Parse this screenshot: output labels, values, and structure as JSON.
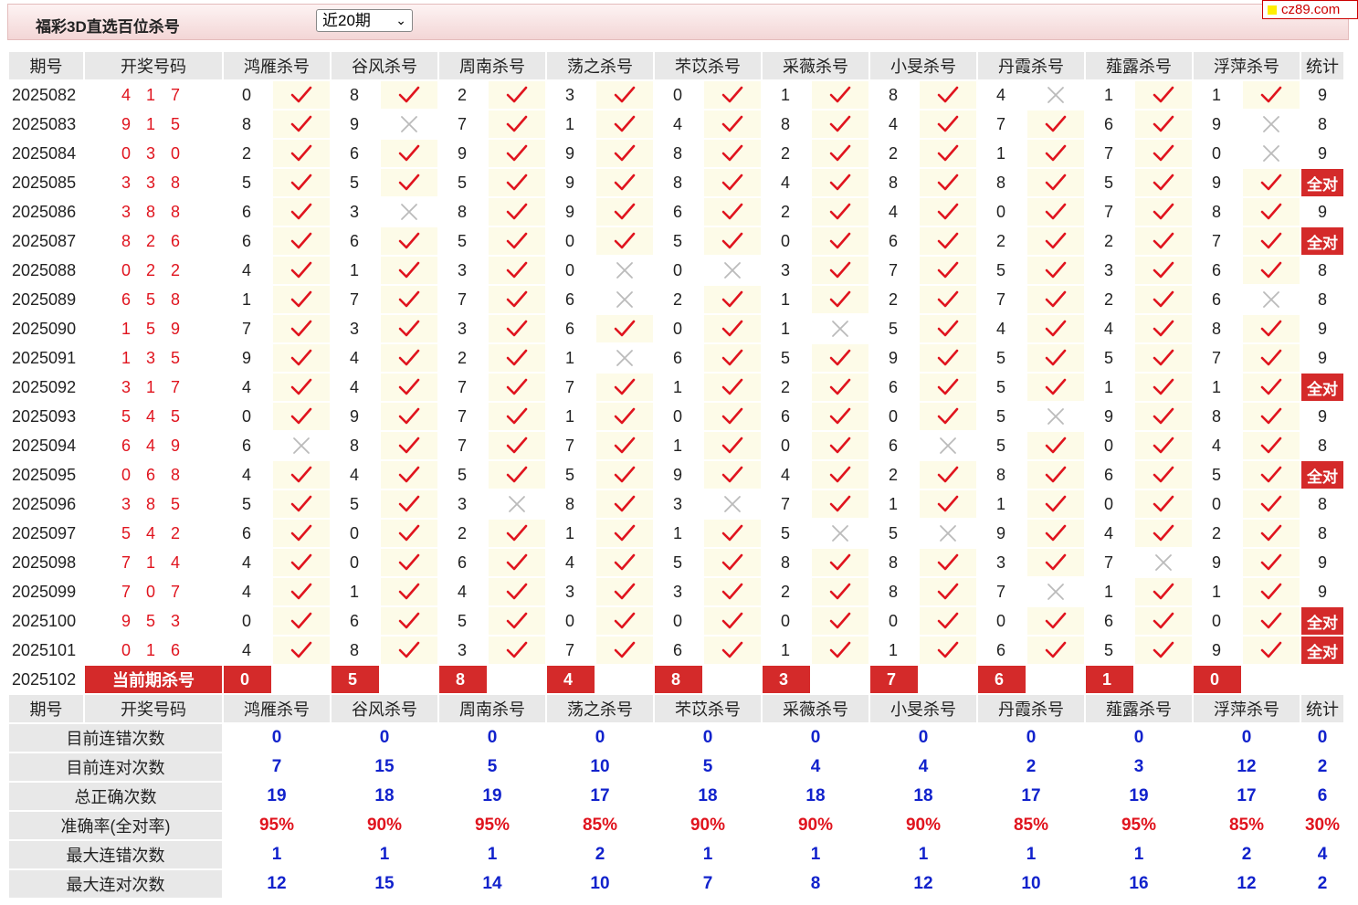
{
  "header": {
    "title": "福彩3D直选百位杀号",
    "period_select": "近20期",
    "logo_text": "cz89.com"
  },
  "columns": {
    "issue": "期号",
    "draw": "开奖号码",
    "experts": [
      "鸿雁杀号",
      "谷风杀号",
      "周南杀号",
      "荡之杀号",
      "芣苡杀号",
      "采薇杀号",
      "小旻杀号",
      "丹霞杀号",
      "薤露杀号",
      "浮萍杀号"
    ],
    "stats": "统计"
  },
  "rows": [
    {
      "issue": "2025082",
      "draw": "4 1 7",
      "kills": [
        0,
        8,
        2,
        3,
        0,
        1,
        8,
        4,
        1,
        1
      ],
      "ok": [
        1,
        1,
        1,
        1,
        1,
        1,
        1,
        0,
        1,
        1
      ],
      "stat": "9"
    },
    {
      "issue": "2025083",
      "draw": "9 1 5",
      "kills": [
        8,
        9,
        7,
        1,
        4,
        8,
        4,
        7,
        6,
        9
      ],
      "ok": [
        1,
        0,
        1,
        1,
        1,
        1,
        1,
        1,
        1,
        0
      ],
      "stat": "8"
    },
    {
      "issue": "2025084",
      "draw": "0 3 0",
      "kills": [
        2,
        6,
        9,
        9,
        8,
        2,
        2,
        1,
        7,
        0
      ],
      "ok": [
        1,
        1,
        1,
        1,
        1,
        1,
        1,
        1,
        1,
        0
      ],
      "stat": "9"
    },
    {
      "issue": "2025085",
      "draw": "3 3 8",
      "kills": [
        5,
        5,
        5,
        9,
        8,
        4,
        8,
        8,
        5,
        9
      ],
      "ok": [
        1,
        1,
        1,
        1,
        1,
        1,
        1,
        1,
        1,
        1
      ],
      "stat": "全对"
    },
    {
      "issue": "2025086",
      "draw": "3 8 8",
      "kills": [
        6,
        3,
        8,
        9,
        6,
        2,
        4,
        0,
        7,
        8
      ],
      "ok": [
        1,
        0,
        1,
        1,
        1,
        1,
        1,
        1,
        1,
        1
      ],
      "stat": "9"
    },
    {
      "issue": "2025087",
      "draw": "8 2 6",
      "kills": [
        6,
        6,
        5,
        0,
        5,
        0,
        6,
        2,
        2,
        7
      ],
      "ok": [
        1,
        1,
        1,
        1,
        1,
        1,
        1,
        1,
        1,
        1
      ],
      "stat": "全对"
    },
    {
      "issue": "2025088",
      "draw": "0 2 2",
      "kills": [
        4,
        1,
        3,
        0,
        0,
        3,
        7,
        5,
        3,
        6
      ],
      "ok": [
        1,
        1,
        1,
        0,
        0,
        1,
        1,
        1,
        1,
        1
      ],
      "stat": "8"
    },
    {
      "issue": "2025089",
      "draw": "6 5 8",
      "kills": [
        1,
        7,
        7,
        6,
        2,
        1,
        2,
        7,
        2,
        6
      ],
      "ok": [
        1,
        1,
        1,
        0,
        1,
        1,
        1,
        1,
        1,
        0
      ],
      "stat": "8"
    },
    {
      "issue": "2025090",
      "draw": "1 5 9",
      "kills": [
        7,
        3,
        3,
        6,
        0,
        1,
        5,
        4,
        4,
        8
      ],
      "ok": [
        1,
        1,
        1,
        1,
        1,
        0,
        1,
        1,
        1,
        1
      ],
      "stat": "9"
    },
    {
      "issue": "2025091",
      "draw": "1 3 5",
      "kills": [
        9,
        4,
        2,
        1,
        6,
        5,
        9,
        5,
        5,
        7
      ],
      "ok": [
        1,
        1,
        1,
        0,
        1,
        1,
        1,
        1,
        1,
        1
      ],
      "stat": "9"
    },
    {
      "issue": "2025092",
      "draw": "3 1 7",
      "kills": [
        4,
        4,
        7,
        7,
        1,
        2,
        6,
        5,
        1,
        1
      ],
      "ok": [
        1,
        1,
        1,
        1,
        1,
        1,
        1,
        1,
        1,
        1
      ],
      "stat": "全对"
    },
    {
      "issue": "2025093",
      "draw": "5 4 5",
      "kills": [
        0,
        9,
        7,
        1,
        0,
        6,
        0,
        5,
        9,
        8
      ],
      "ok": [
        1,
        1,
        1,
        1,
        1,
        1,
        1,
        0,
        1,
        1
      ],
      "stat": "9"
    },
    {
      "issue": "2025094",
      "draw": "6 4 9",
      "kills": [
        6,
        8,
        7,
        7,
        1,
        0,
        6,
        5,
        0,
        4
      ],
      "ok": [
        0,
        1,
        1,
        1,
        1,
        1,
        0,
        1,
        1,
        1
      ],
      "stat": "8"
    },
    {
      "issue": "2025095",
      "draw": "0 6 8",
      "kills": [
        4,
        4,
        5,
        5,
        9,
        4,
        2,
        8,
        6,
        5
      ],
      "ok": [
        1,
        1,
        1,
        1,
        1,
        1,
        1,
        1,
        1,
        1
      ],
      "stat": "全对"
    },
    {
      "issue": "2025096",
      "draw": "3 8 5",
      "kills": [
        5,
        5,
        3,
        8,
        3,
        7,
        1,
        1,
        0,
        0
      ],
      "ok": [
        1,
        1,
        0,
        1,
        0,
        1,
        1,
        1,
        1,
        1
      ],
      "stat": "8"
    },
    {
      "issue": "2025097",
      "draw": "5 4 2",
      "kills": [
        6,
        0,
        2,
        1,
        1,
        5,
        5,
        9,
        4,
        2
      ],
      "ok": [
        1,
        1,
        1,
        1,
        1,
        0,
        0,
        1,
        1,
        1
      ],
      "stat": "8"
    },
    {
      "issue": "2025098",
      "draw": "7 1 4",
      "kills": [
        4,
        0,
        6,
        4,
        5,
        8,
        8,
        3,
        7,
        9
      ],
      "ok": [
        1,
        1,
        1,
        1,
        1,
        1,
        1,
        1,
        0,
        1
      ],
      "stat": "9"
    },
    {
      "issue": "2025099",
      "draw": "7 0 7",
      "kills": [
        4,
        1,
        4,
        3,
        3,
        2,
        8,
        7,
        1,
        1
      ],
      "ok": [
        1,
        1,
        1,
        1,
        1,
        1,
        1,
        0,
        1,
        1
      ],
      "stat": "9"
    },
    {
      "issue": "2025100",
      "draw": "9 5 3",
      "kills": [
        0,
        6,
        5,
        0,
        0,
        0,
        0,
        0,
        6,
        0
      ],
      "ok": [
        1,
        1,
        1,
        1,
        1,
        1,
        1,
        1,
        1,
        1
      ],
      "stat": "全对"
    },
    {
      "issue": "2025101",
      "draw": "0 1 6",
      "kills": [
        4,
        8,
        3,
        7,
        6,
        1,
        1,
        6,
        5,
        9
      ],
      "ok": [
        1,
        1,
        1,
        1,
        1,
        1,
        1,
        1,
        1,
        1
      ],
      "stat": "全对"
    }
  ],
  "current": {
    "issue": "2025102",
    "label": "当前期杀号",
    "kills": [
      "0",
      "5",
      "8",
      "4",
      "8",
      "3",
      "7",
      "6",
      "1",
      "0"
    ]
  },
  "summary": [
    {
      "label": "目前连错次数",
      "values": [
        "0",
        "0",
        "0",
        "0",
        "0",
        "0",
        "0",
        "0",
        "0",
        "0"
      ],
      "stat": "0",
      "color": "blue"
    },
    {
      "label": "目前连对次数",
      "values": [
        "7",
        "15",
        "5",
        "10",
        "5",
        "4",
        "4",
        "2",
        "3",
        "12"
      ],
      "stat": "2",
      "color": "blue"
    },
    {
      "label": "总正确次数",
      "values": [
        "19",
        "18",
        "19",
        "17",
        "18",
        "18",
        "18",
        "17",
        "19",
        "17"
      ],
      "stat": "6",
      "color": "blue"
    },
    {
      "label": "准确率(全对率)",
      "values": [
        "95%",
        "90%",
        "95%",
        "85%",
        "90%",
        "90%",
        "90%",
        "85%",
        "95%",
        "85%"
      ],
      "stat": "30%",
      "color": "red"
    },
    {
      "label": "最大连错次数",
      "values": [
        "1",
        "1",
        "1",
        "2",
        "1",
        "1",
        "1",
        "1",
        "1",
        "2"
      ],
      "stat": "4",
      "color": "blue"
    },
    {
      "label": "最大连对次数",
      "values": [
        "12",
        "15",
        "14",
        "10",
        "7",
        "8",
        "12",
        "10",
        "16",
        "12"
      ],
      "stat": "2",
      "color": "blue"
    }
  ],
  "colors": {
    "correct": "#e0141e",
    "wrong": "#bbbbbb",
    "accent": "#d42a2a",
    "blue": "#1122cc"
  }
}
